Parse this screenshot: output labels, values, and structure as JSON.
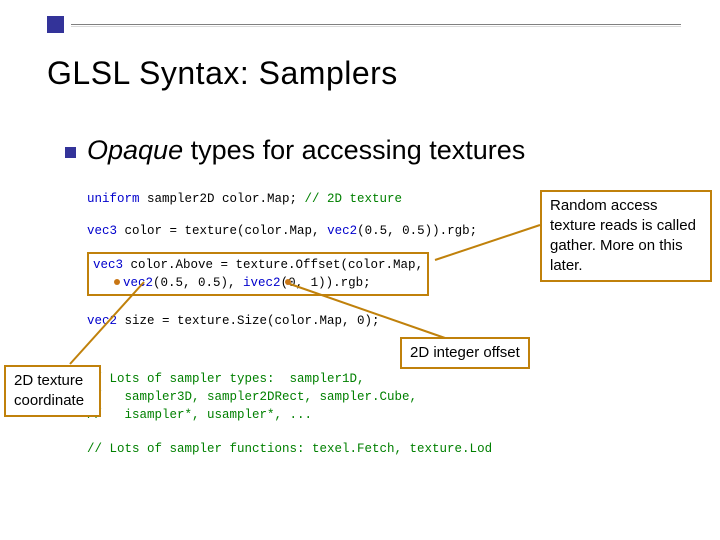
{
  "title": "GLSL Syntax:  Samplers",
  "subhead_italic": "Opaque",
  "subhead_rest": " types for accessing textures",
  "code": {
    "l1_a": "uniform",
    "l1_b": " sampler2D color.Map; ",
    "l1_c": "// 2D texture",
    "l2_a": "vec3",
    "l2_b": " color = texture(color.Map, ",
    "l2_c": "vec2",
    "l2_d": "(0.5, 0.5)).rgb;",
    "l3_a": "vec3",
    "l3_b": " color.Above = texture.Offset(color.Map,",
    "l4_a": "    ",
    "l4_b": "vec2",
    "l4_c": "(0.5, 0.5), ",
    "l4_d": "ivec2",
    "l4_e": "(0, 1)).rgb;",
    "l5_a": "vec2",
    "l5_b": " size = texture.Size(color.Map, 0);",
    "l6": "// Lots of sampler types:  sampler1D,",
    "l7": "//   sampler3D, sampler2DRect, sampler.Cube,",
    "l8": "//   isampler*, usampler*, ...",
    "l9": "// Lots of sampler functions: texel.Fetch, texture.Lod"
  },
  "callouts": {
    "random": "Random access texture reads is called gather.  More on this later.",
    "offset": "2D integer offset",
    "coord": "2D texture coordinate"
  }
}
